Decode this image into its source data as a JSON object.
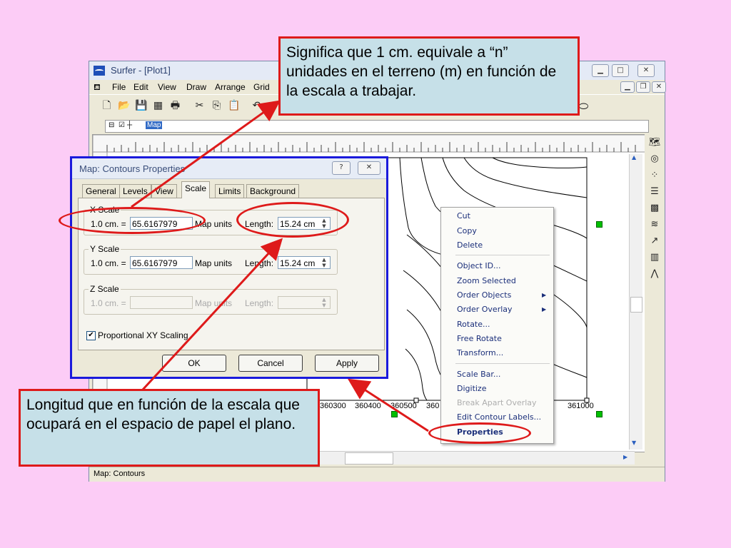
{
  "window": {
    "title": "Surfer - [Plot1]",
    "menu": [
      "File",
      "Edit",
      "View",
      "Draw",
      "Arrange",
      "Grid"
    ],
    "object_tree_label": "Map",
    "status": "Map: Contours"
  },
  "dialog": {
    "title": "Map: Contours Properties",
    "tabs": [
      "General",
      "Levels",
      "View",
      "Scale",
      "Limits",
      "Background"
    ],
    "active_tab": "Scale",
    "x_scale": {
      "group": "X Scale",
      "prefix": "1.0 cm. =",
      "value": "65.6167979",
      "unit": "Map units",
      "length_label": "Length:",
      "length_value": "15.24 cm"
    },
    "y_scale": {
      "group": "Y Scale",
      "prefix": "1.0 cm. =",
      "value": "65.6167979",
      "unit": "Map units",
      "length_label": "Length:",
      "length_value": "15.24 cm"
    },
    "z_scale": {
      "group": "Z Scale",
      "prefix": "1.0 cm. =",
      "value": "",
      "unit": "Map units",
      "length_label": "Length:",
      "length_value": ""
    },
    "proportional_label": "Proportional XY Scaling",
    "proportional_checked": true,
    "buttons": {
      "ok": "OK",
      "cancel": "Cancel",
      "apply": "Apply"
    }
  },
  "context_menu": {
    "cut": "Cut",
    "copy": "Copy",
    "delete": "Delete",
    "object_id": "Object ID...",
    "zoom_selected": "Zoom Selected",
    "order_objects": "Order Objects",
    "order_overlay": "Order Overlay",
    "rotate": "Rotate...",
    "free_rotate": "Free Rotate",
    "transform": "Transform...",
    "scale_bar": "Scale Bar...",
    "digitize": "Digitize",
    "break_apart": "Break Apart Overlay",
    "edit_contour_labels": "Edit Contour Labels...",
    "properties": "Properties"
  },
  "map_axis_labels": [
    "360300",
    "360400",
    "360500",
    "360",
    "361000"
  ],
  "callouts": {
    "top": "Significa que 1 cm. equivale a “n” unidades  en el terreno (m) en función de la escala a trabajar.",
    "bottom": "Longitud que en función de la escala que ocupará en el espacio de papel el plano."
  },
  "colors": {
    "background": "#FCCCF6",
    "callout_fill": "#C6E0E8",
    "callout_border": "#DE1A1A",
    "dialog_border": "#1A1ADC",
    "menu_text": "#1B2F7A"
  }
}
